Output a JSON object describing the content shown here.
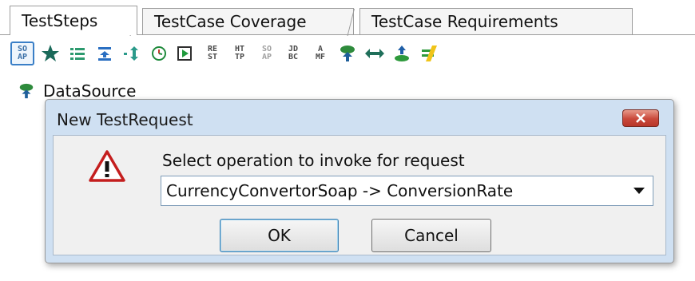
{
  "tabs": [
    {
      "label": "TestSteps",
      "active": true
    },
    {
      "label": "TestCase Coverage",
      "active": false
    },
    {
      "label": "TestCase Requirements",
      "active": false
    }
  ],
  "toolbar": {
    "soap_label": [
      "SO",
      "AP"
    ],
    "rest_label": [
      "RE",
      "ST"
    ],
    "http_label": [
      "HT",
      "TP"
    ],
    "soap2_label": [
      "SO",
      "AP"
    ],
    "jdbc_label": [
      "JD",
      "BC"
    ],
    "amf_label": [
      "A",
      "MF"
    ],
    "icons": [
      "soap-request-icon",
      "star-icon",
      "list-icon",
      "move-down-icon",
      "property-transfer-icon",
      "delay-clock-icon",
      "run-icon",
      "rest-request-icon",
      "http-request-icon",
      "soap-mock-icon",
      "jdbc-request-icon",
      "amf-request-icon",
      "datasource-icon",
      "datasource-loop-icon",
      "datasink-icon",
      "assertion-icon"
    ]
  },
  "tree": {
    "item_label": "DataSource",
    "item_icon": "datasource-icon"
  },
  "dialog": {
    "title": "New TestRequest",
    "prompt": "Select operation to invoke for request",
    "selected_operation": "CurrencyConvertorSoap -> ConversionRate",
    "ok_label": "OK",
    "cancel_label": "Cancel",
    "icon": "warning-icon"
  },
  "colors": {
    "dialog_frame": "#cfe0f2",
    "close_button": "#c9483a",
    "active_button_border": "#3c7fb1"
  }
}
